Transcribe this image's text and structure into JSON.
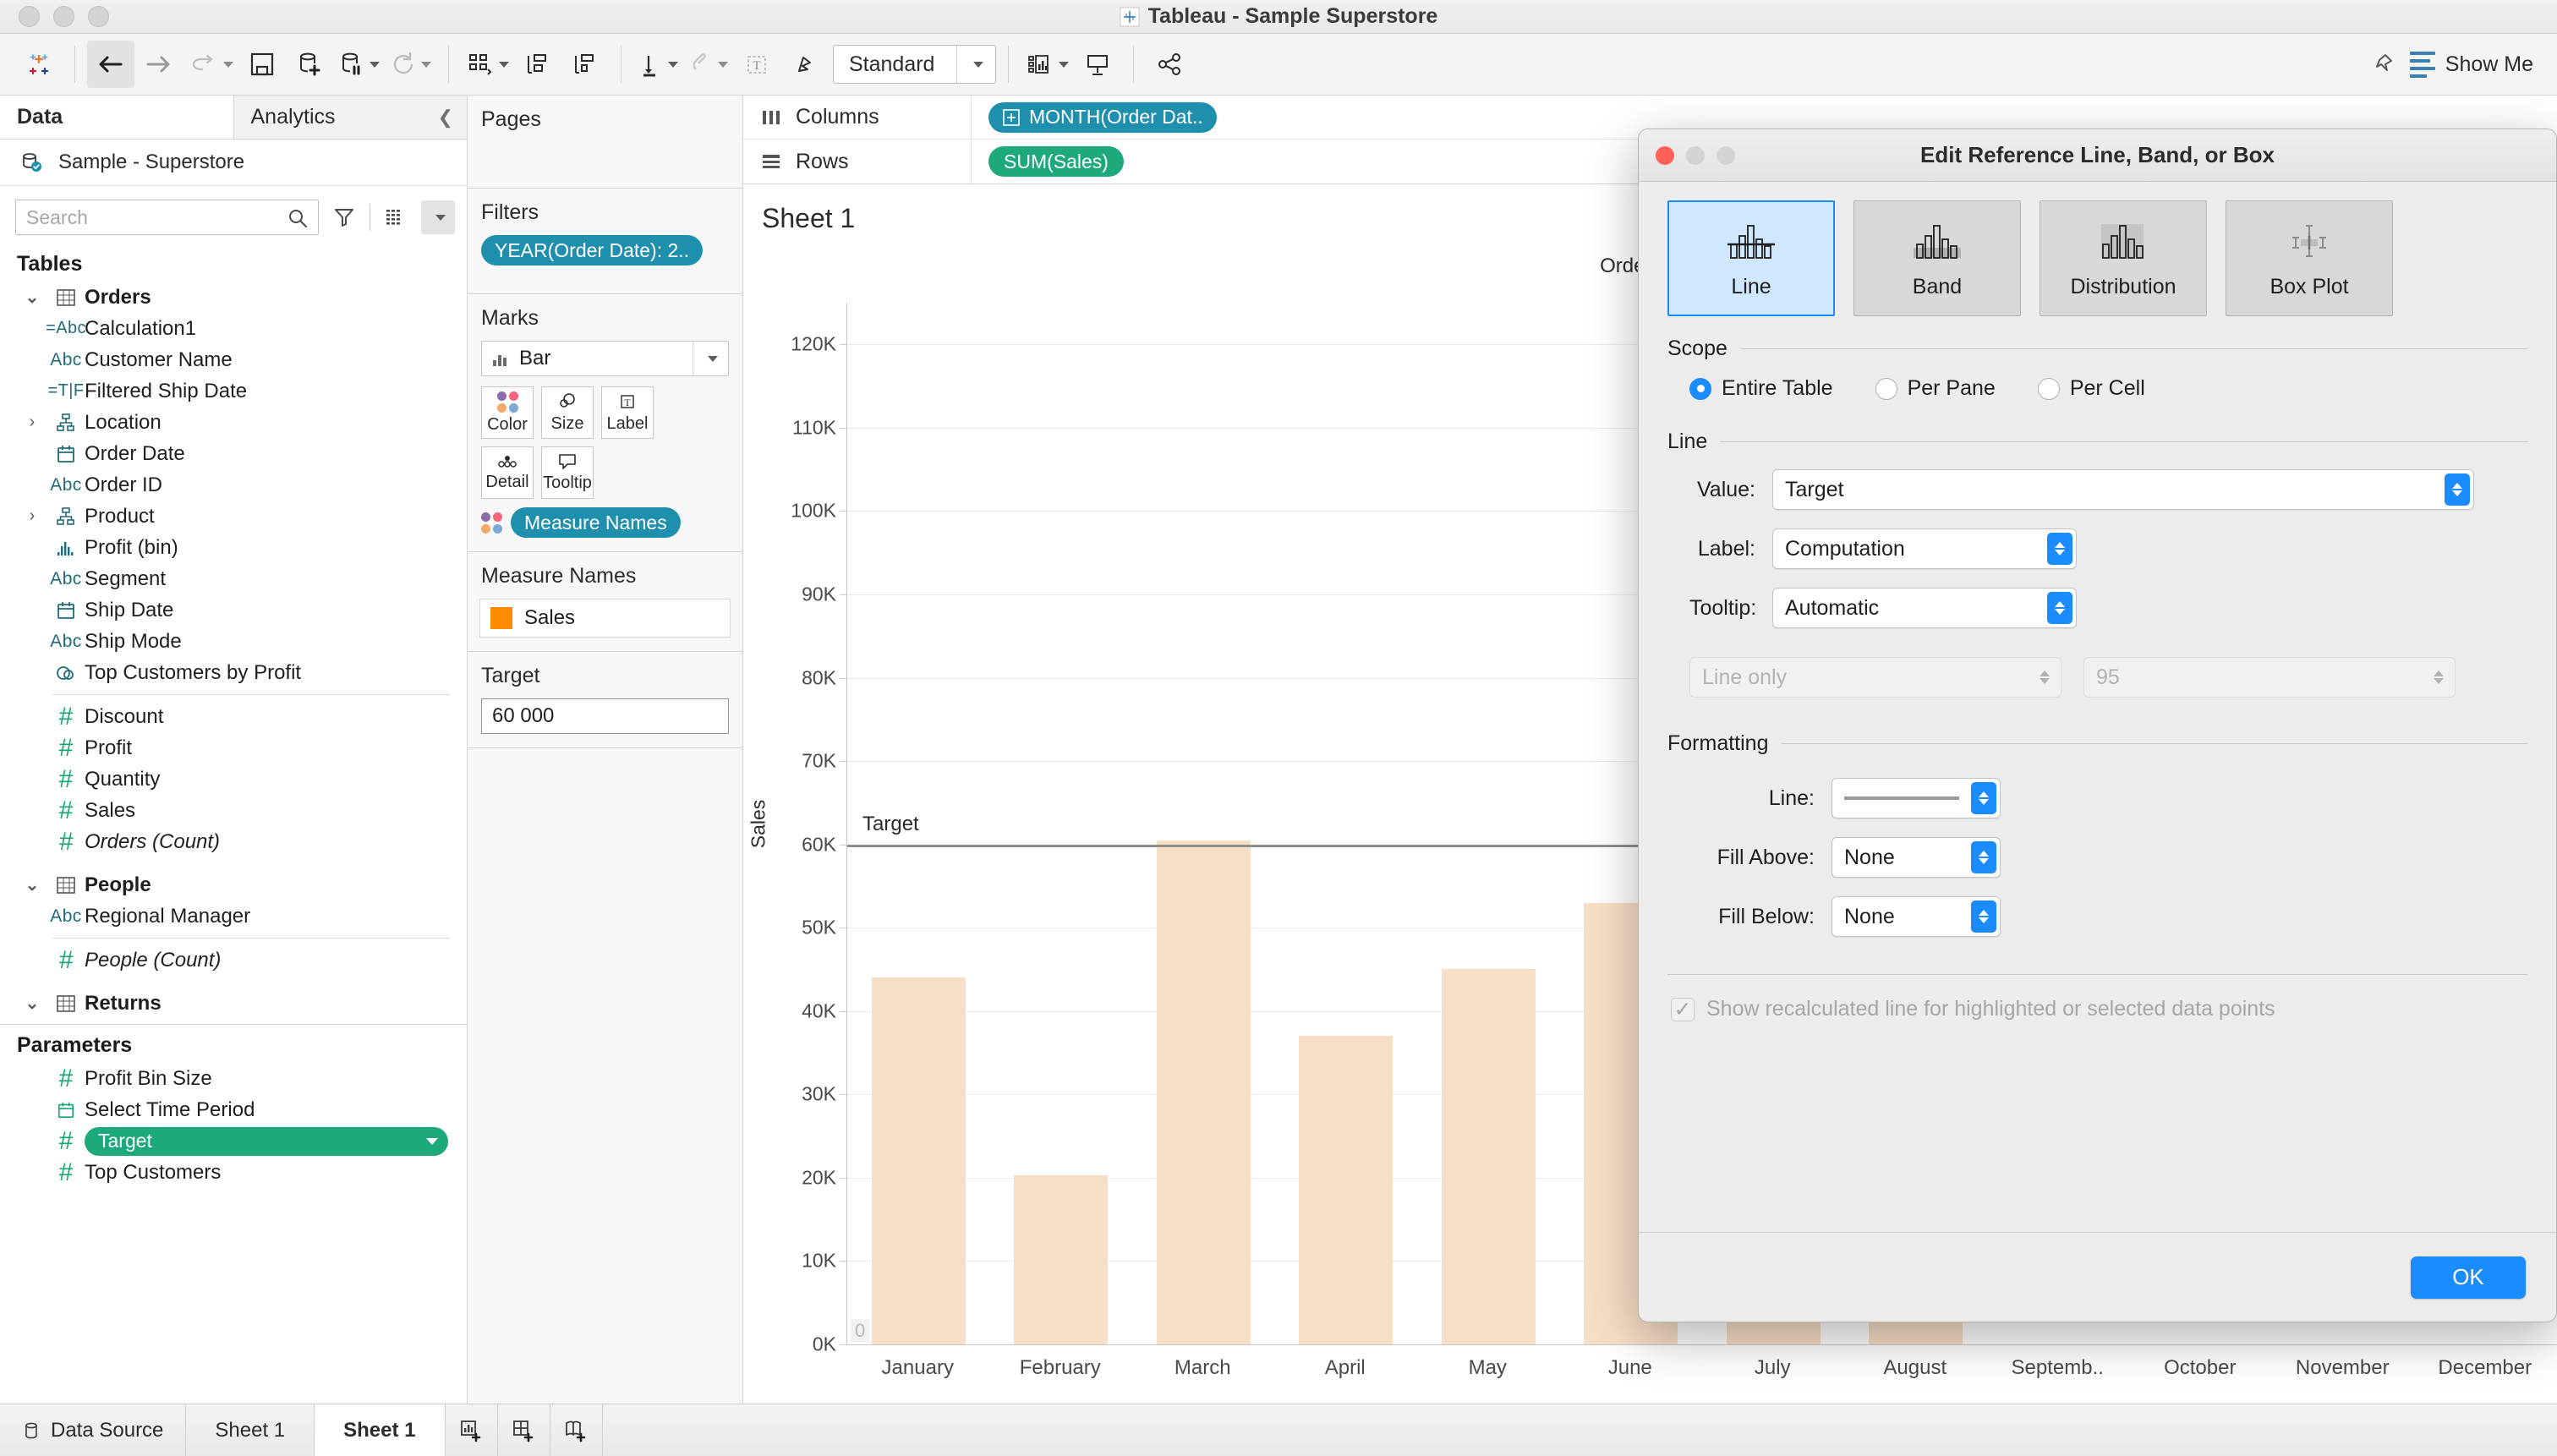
{
  "window": {
    "title": "Tableau - Sample Superstore"
  },
  "toolbar": {
    "items": [
      {
        "name": "tableau-logo-icon",
        "label": "Tableau"
      },
      {
        "name": "back-icon",
        "label": "Back"
      },
      {
        "name": "forward-icon",
        "label": "Forward"
      },
      {
        "name": "undo-icon",
        "label": "Undo"
      },
      {
        "name": "save-icon",
        "label": "Save"
      },
      {
        "name": "new-data-source-icon",
        "label": "New Data Source"
      },
      {
        "name": "pause-data-source-icon",
        "label": "Pause Auto Updates"
      },
      {
        "name": "refresh-icon",
        "label": "Refresh Data Source"
      },
      {
        "name": "new-worksheet-icon",
        "label": "New Worksheet"
      },
      {
        "name": "clear-sheet-icon",
        "label": "Clear Sheet"
      },
      {
        "name": "swap-axes-icon",
        "label": "Swap Rows and Columns"
      },
      {
        "name": "sort-ascending-icon",
        "label": "Sort Ascending"
      },
      {
        "name": "sort-descending-icon",
        "label": "Sort Descending"
      },
      {
        "name": "highlighter-icon",
        "label": "Highlight"
      },
      {
        "name": "group-members-icon",
        "label": "Group Members"
      },
      {
        "name": "show-mark-labels-icon",
        "label": "Show Mark Labels"
      },
      {
        "name": "fix-axes-icon",
        "label": "Fix Axes"
      }
    ],
    "fit_value": "Standard",
    "show_me_label": "Show Me",
    "presentation_icon": "presentation-mode-icon",
    "share_icon": "share-icon",
    "highlight_icon": "highlighter-icon"
  },
  "data_pane": {
    "tabs": [
      {
        "label": "Data",
        "selected": true
      },
      {
        "label": "Analytics",
        "selected": false
      }
    ],
    "collapse_icon": "chevron-left-icon",
    "data_source": "Sample - Superstore",
    "search_placeholder": "Search",
    "search_value": "",
    "tables_header": "Tables",
    "groups": [
      {
        "name": "Orders",
        "expanded": true,
        "icon": "table-icon",
        "fields": [
          {
            "label": "Calculation1",
            "type": "calc-string",
            "icon": "abc-calc-icon"
          },
          {
            "label": "Customer Name",
            "type": "string",
            "icon": "abc-icon"
          },
          {
            "label": "Filtered Ship Date",
            "type": "calc-boolean",
            "icon": "tf-calc-icon"
          },
          {
            "label": "Location",
            "type": "hierarchy",
            "icon": "hierarchy-icon",
            "expandable": true
          },
          {
            "label": "Order Date",
            "type": "date",
            "icon": "calendar-icon"
          },
          {
            "label": "Order ID",
            "type": "string",
            "icon": "abc-icon"
          },
          {
            "label": "Product",
            "type": "hierarchy",
            "icon": "hierarchy-icon",
            "expandable": true
          },
          {
            "label": "Profit (bin)",
            "type": "bin",
            "icon": "bin-icon"
          },
          {
            "label": "Segment",
            "type": "string",
            "icon": "abc-icon"
          },
          {
            "label": "Ship Date",
            "type": "date",
            "icon": "calendar-icon"
          },
          {
            "label": "Ship Mode",
            "type": "string",
            "icon": "abc-icon"
          },
          {
            "label": "Top Customers by Profit",
            "type": "set",
            "icon": "set-icon"
          },
          {
            "divider": true
          },
          {
            "label": "Discount",
            "type": "measure",
            "icon": "number-icon"
          },
          {
            "label": "Profit",
            "type": "measure",
            "icon": "number-icon"
          },
          {
            "label": "Quantity",
            "type": "measure",
            "icon": "number-icon"
          },
          {
            "label": "Sales",
            "type": "measure",
            "icon": "number-icon"
          },
          {
            "label": "Orders (Count)",
            "type": "measure",
            "icon": "number-icon",
            "italic": true
          }
        ]
      },
      {
        "name": "People",
        "expanded": true,
        "icon": "table-icon",
        "fields": [
          {
            "label": "Regional Manager",
            "type": "string",
            "icon": "abc-icon"
          },
          {
            "divider": true
          },
          {
            "label": "People (Count)",
            "type": "measure",
            "icon": "number-icon",
            "italic": true
          }
        ]
      },
      {
        "name": "Returns",
        "expanded": true,
        "icon": "table-icon",
        "fields": []
      }
    ],
    "parameters_header": "Parameters",
    "parameters": [
      {
        "label": "Profit Bin Size",
        "icon": "number-icon",
        "selected": false
      },
      {
        "label": "Select Time Period",
        "icon": "calendar-green-icon",
        "selected": false
      },
      {
        "label": "Target",
        "icon": "number-icon",
        "selected": true
      },
      {
        "label": "Top Customers",
        "icon": "number-icon",
        "selected": false
      }
    ]
  },
  "cards": {
    "pages": {
      "title": "Pages"
    },
    "filters": {
      "title": "Filters",
      "pills": [
        "YEAR(Order Date): 2.."
      ]
    },
    "marks": {
      "title": "Marks",
      "mark_type": "Bar",
      "mark_type_icon": "bar-mark-icon",
      "buttons": [
        {
          "label": "Color",
          "icon": "color-icon"
        },
        {
          "label": "Size",
          "icon": "size-icon"
        },
        {
          "label": "Label",
          "icon": "label-icon"
        },
        {
          "label": "Detail",
          "icon": "detail-icon"
        },
        {
          "label": "Tooltip",
          "icon": "tooltip-icon"
        }
      ],
      "pills": [
        {
          "label": "Measure Names",
          "icon": "color-icon"
        }
      ]
    },
    "legend": {
      "title": "Measure Names",
      "items": [
        {
          "label": "Sales",
          "color": "#ff8c00"
        }
      ]
    },
    "parameter_card": {
      "title": "Target",
      "value": "60 000"
    }
  },
  "shelves": {
    "columns": {
      "label": "Columns",
      "icon": "columns-icon",
      "pills": [
        "MONTH(Order Dat.."
      ]
    },
    "rows": {
      "label": "Rows",
      "icon": "rows-icon",
      "pills": [
        "SUM(Sales)"
      ]
    }
  },
  "worksheet": {
    "title": "Sheet 1"
  },
  "status_bar": {
    "data_source_label": "Data Source",
    "data_source_icon": "database-icon",
    "tabs": [
      {
        "label": "Sheet 1",
        "active": false
      },
      {
        "label": "Sheet 1",
        "active": true
      }
    ],
    "new_buttons": [
      {
        "icon": "new-worksheet-icon"
      },
      {
        "icon": "new-dashboard-icon"
      },
      {
        "icon": "new-story-icon"
      }
    ]
  },
  "modal": {
    "title": "Edit Reference Line, Band, or Box",
    "traffic": [
      "close",
      "minimize",
      "zoom"
    ],
    "types": [
      {
        "label": "Line",
        "icon": "reference-line-icon",
        "selected": true
      },
      {
        "label": "Band",
        "icon": "reference-band-icon",
        "selected": false
      },
      {
        "label": "Distribution",
        "icon": "reference-distribution-icon",
        "selected": false
      },
      {
        "label": "Box Plot",
        "icon": "reference-boxplot-icon",
        "selected": false
      }
    ],
    "scope": {
      "title": "Scope",
      "options": [
        {
          "label": "Entire Table",
          "selected": true
        },
        {
          "label": "Per Pane",
          "selected": false
        },
        {
          "label": "Per Cell",
          "selected": false
        }
      ]
    },
    "line": {
      "title": "Line",
      "fields": [
        {
          "label": "Value:",
          "value": "Target",
          "wide": true,
          "disabled": false
        },
        {
          "label": "Label:",
          "value": "Computation",
          "wide": false,
          "disabled": false
        },
        {
          "label": "Tooltip:",
          "value": "Automatic",
          "wide": false,
          "disabled": false
        }
      ],
      "disabled_fields": [
        {
          "value": "Line only"
        },
        {
          "value": "95"
        }
      ]
    },
    "formatting": {
      "title": "Formatting",
      "fields": [
        {
          "label": "Line:",
          "value": "",
          "is_line_preview": true
        },
        {
          "label": "Fill Above:",
          "value": "None",
          "is_line_preview": false
        },
        {
          "label": "Fill Below:",
          "value": "None",
          "is_line_preview": false
        }
      ]
    },
    "checkbox": {
      "label": "Show recalculated line for highlighted or selected data points",
      "checked": true,
      "disabled": true
    },
    "ok_label": "OK",
    "accent_color": "#1a8cff"
  },
  "chart_data": {
    "type": "bar",
    "title": "Sheet 1",
    "column_header": "Order Date",
    "xlabel": "",
    "ylabel": "Sales",
    "categories": [
      "January",
      "February",
      "March",
      "April",
      "May",
      "June",
      "July",
      "August",
      "Septemb..",
      "October",
      "November",
      "December"
    ],
    "values": [
      44000,
      20300,
      60500,
      37000,
      45000,
      53000,
      45500,
      63000,
      null,
      null,
      null,
      null
    ],
    "ylim": [
      0,
      125000
    ],
    "yticks": [
      0,
      10000,
      20000,
      30000,
      40000,
      50000,
      60000,
      70000,
      80000,
      90000,
      100000,
      110000,
      120000
    ],
    "ytick_labels": [
      "0K",
      "10K",
      "20K",
      "30K",
      "40K",
      "50K",
      "60K",
      "70K",
      "80K",
      "90K",
      "100K",
      "110K",
      "120K"
    ],
    "bar_color": "#f7dfc7",
    "grid": true,
    "legend_position": "right",
    "reference_line": {
      "label": "Target",
      "value": 60000,
      "color": "#8e8e8e"
    },
    "zero_label": "0"
  }
}
